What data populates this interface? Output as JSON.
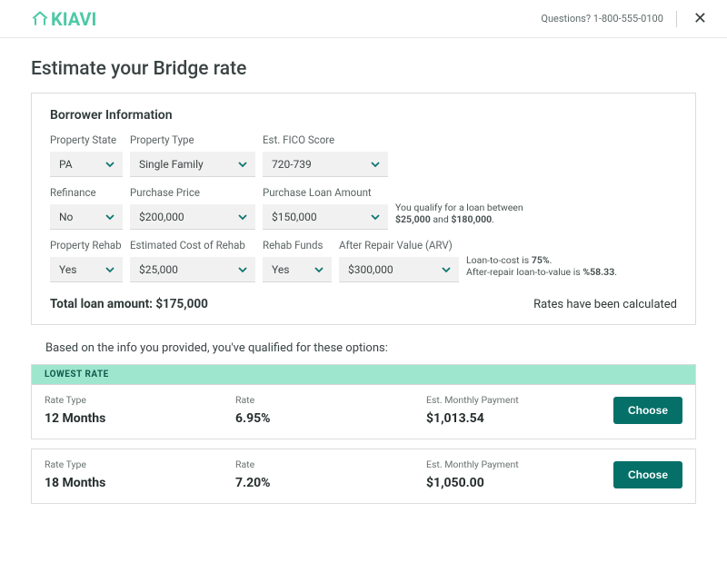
{
  "header": {
    "brand": "KIAVI",
    "questions_label": "Questions? 1-800-555-0100"
  },
  "page": {
    "title": "Estimate your Bridge rate"
  },
  "form": {
    "section_title": "Borrower Information",
    "property_state": {
      "label": "Property State",
      "value": "PA"
    },
    "property_type": {
      "label": "Property Type",
      "value": "Single Family"
    },
    "fico": {
      "label": "Est. FICO Score",
      "value": "720-739"
    },
    "refinance": {
      "label": "Refinance",
      "value": "No"
    },
    "purchase_price": {
      "label": "Purchase Price",
      "value": "$200,000"
    },
    "purchase_loan_amount": {
      "label": "Purchase Loan Amount",
      "value": "$150,000"
    },
    "loan_range_prefix": "You qualify for a loan between",
    "loan_range_min": "$25,000",
    "loan_range_and": " and ",
    "loan_range_max": "$180,000",
    "property_rehab": {
      "label": "Property Rehab",
      "value": "Yes"
    },
    "rehab_cost": {
      "label": "Estimated Cost of Rehab",
      "value": "$25,000"
    },
    "rehab_funds": {
      "label": "Rehab Funds",
      "value": "Yes"
    },
    "arv": {
      "label": "After Repair Value (ARV)",
      "value": "$300,000"
    },
    "ltc_prefix": "Loan-to-cost is ",
    "ltc_value": "75%",
    "ltv_prefix": "After-repair loan-to-value is ",
    "ltv_value": "%58.33",
    "total_label": "Total loan amount: ",
    "total_value": "$175,000",
    "rates_calculated": "Rates have been calculated"
  },
  "results": {
    "intro": "Based on the info you provided, you've qualified for these options:",
    "badge_lowest": "LOWEST RATE",
    "col_rate_type": "Rate Type",
    "col_rate": "Rate",
    "col_payment": "Est. Monthly Payment",
    "choose_label": "Choose",
    "options": [
      {
        "term": "12 Months",
        "rate": "6.95%",
        "payment": "$1,013.54"
      },
      {
        "term": "18 Months",
        "rate": "7.20%",
        "payment": "$1,050.00"
      }
    ]
  }
}
